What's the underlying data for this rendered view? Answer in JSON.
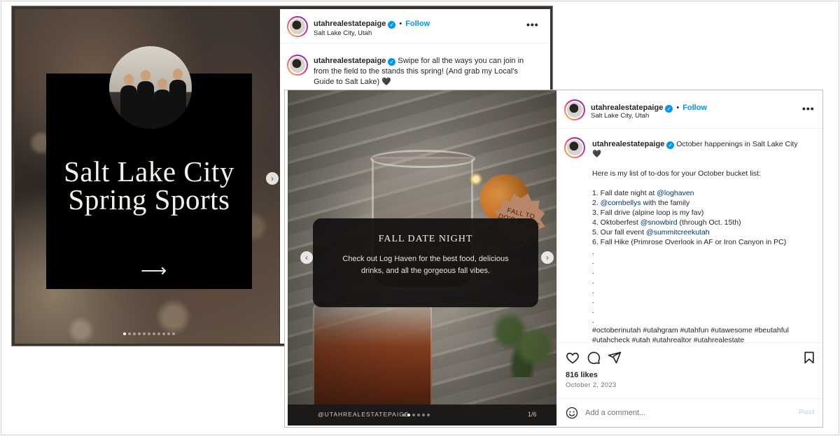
{
  "post1": {
    "slide": {
      "title_line1": "Salt Lake City",
      "title_line2": "Spring Sports",
      "arrow": "⟶"
    },
    "header": {
      "username": "utahrealestatepaige",
      "follow_label": "Follow",
      "separator": "•",
      "location": "Salt Lake City, Utah",
      "more": "•••"
    },
    "caption": {
      "username": "utahrealestatepaige",
      "text": "Swipe for all the ways you can join in from the field to the stands this spring! (And grab my Local's Guide to Salt Lake) 🖤"
    },
    "carousel": {
      "total": 11,
      "active": 0
    }
  },
  "post2": {
    "slide": {
      "badge": "FALL TO DO'S IN SLC",
      "card_title": "FALL DATE NIGHT",
      "card_body": "Check out Log Haven for the best food, delicious drinks, and all the gorgeous fall vibes.",
      "handle": "@UTAHREALESTATEPAIGE",
      "counter": "1/6"
    },
    "carousel": {
      "total": 6,
      "active": 1
    },
    "header": {
      "username": "utahrealestatepaige",
      "follow_label": "Follow",
      "separator": "•",
      "location": "Salt Lake City, Utah",
      "more": "•••"
    },
    "caption": {
      "username": "utahrealestatepaige",
      "first_line_rest": "October happenings in Salt Lake City",
      "first_line_wrap": "🖤",
      "intro": "Here is my list of to-dos for your October bucket list:",
      "items": [
        {
          "pre": "1. Fall date night at ",
          "mention": "@loghaven",
          "post": ""
        },
        {
          "pre": "2. ",
          "mention": "@cornbellys",
          "post": " with the family"
        },
        {
          "pre": "3. Fall drive (alpine loop is my fav)",
          "mention": "",
          "post": ""
        },
        {
          "pre": "4. Oktoberfest ",
          "mention": "@snowbird",
          "post": " (through Oct. 15th)"
        },
        {
          "pre": "5. Our fall event ",
          "mention": "@summitcreekutah",
          "post": ""
        },
        {
          "pre": "6. Fall Hike (Primrose Overlook in AF or Iron Canyon in PC)",
          "mention": "",
          "post": ""
        }
      ],
      "spacer_dots": [
        ".",
        ".",
        ".",
        ".",
        ".",
        ".",
        ".",
        "."
      ],
      "hashtags_line1": "#octoberinutah #utahgram #utahfun #utawesome #beutahful",
      "hashtags_line2": "#utahcheck #utah #utahrealtor #utahrealestate"
    },
    "likes": "816 likes",
    "date": "October 2, 2023",
    "comment": {
      "placeholder": "Add a comment...",
      "post_label": "Post"
    }
  },
  "colors": {
    "link_blue": "#0095f6",
    "mention_blue": "#00376b",
    "card_black": "#000000",
    "badge_tan": "#b8876a"
  }
}
